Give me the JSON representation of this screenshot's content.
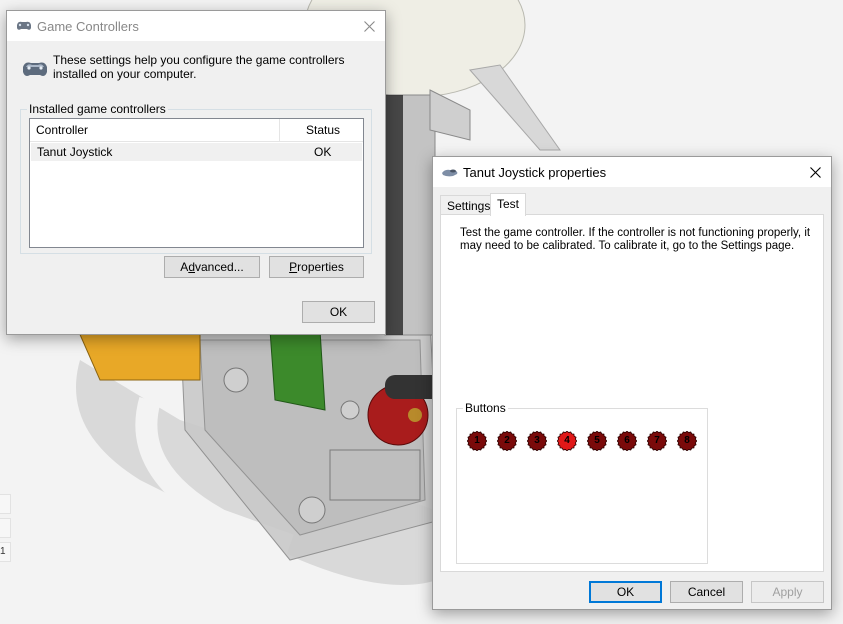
{
  "game_controllers": {
    "title": "Game Controllers",
    "intro": "These settings help you configure the game controllers installed on your computer.",
    "group_label": "Installed game controllers",
    "columns": [
      "Controller",
      "Status"
    ],
    "rows": [
      {
        "controller": "Tanut Joystick",
        "status": "OK"
      }
    ],
    "advanced_label_prefix": "A",
    "advanced_label_mnemonic": "d",
    "advanced_label_rest": "vanced...",
    "properties_label_mnemonic": "P",
    "properties_label_rest": "roperties",
    "ok_label": "OK"
  },
  "joystick_properties": {
    "title": "Tanut Joystick properties",
    "tabs": [
      "Settings",
      "Test"
    ],
    "active_tab": "Test",
    "description": "Test the game controller.  If the controller is not functioning properly, it may need to be calibrated.  To calibrate it, go to the Settings page.",
    "buttons_group_label": "Buttons",
    "buttons": [
      {
        "label": "1",
        "pressed": false
      },
      {
        "label": "2",
        "pressed": false
      },
      {
        "label": "3",
        "pressed": false
      },
      {
        "label": "4",
        "pressed": true
      },
      {
        "label": "5",
        "pressed": false
      },
      {
        "label": "6",
        "pressed": false
      },
      {
        "label": "7",
        "pressed": false
      },
      {
        "label": "8",
        "pressed": false
      }
    ],
    "ok_label": "OK",
    "cancel_label": "Cancel",
    "apply_label": "Apply"
  },
  "edge_tabs": [
    "1"
  ],
  "colors": {
    "led_off": "#7a0a0a",
    "led_on": "#e01818",
    "accent": "#0078d7"
  }
}
